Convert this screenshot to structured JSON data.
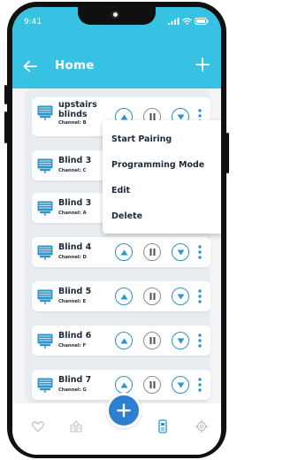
{
  "status_bar": {
    "time": "9:41"
  },
  "header": {
    "title": "Home"
  },
  "blinds": [
    {
      "name": "upstairs blinds",
      "channel": "Channel: B"
    },
    {
      "name": "Blind 3",
      "channel": "Channel: C"
    },
    {
      "name": "Blind 3",
      "channel": "Channel: A"
    },
    {
      "name": "Blind 4",
      "channel": "Channel: D"
    },
    {
      "name": "Blind 5",
      "channel": "Channel: E"
    },
    {
      "name": "Blind 6",
      "channel": "Channel: F"
    },
    {
      "name": "Blind 7",
      "channel": "Channel: G"
    }
  ],
  "context_menu": {
    "start_pairing": "Start Pairing",
    "programming_mode": "Programming Mode",
    "edit": "Edit",
    "delete": "Delete"
  },
  "bottom_nav": {
    "items": [
      "heart-icon",
      "group-icon",
      "add-icon",
      "remote-icon",
      "settings-icon"
    ],
    "active": "remote-icon"
  },
  "colors": {
    "accent": "#37c2e3",
    "fab": "#2f7fd1",
    "control_blue": "#2e94c9"
  }
}
